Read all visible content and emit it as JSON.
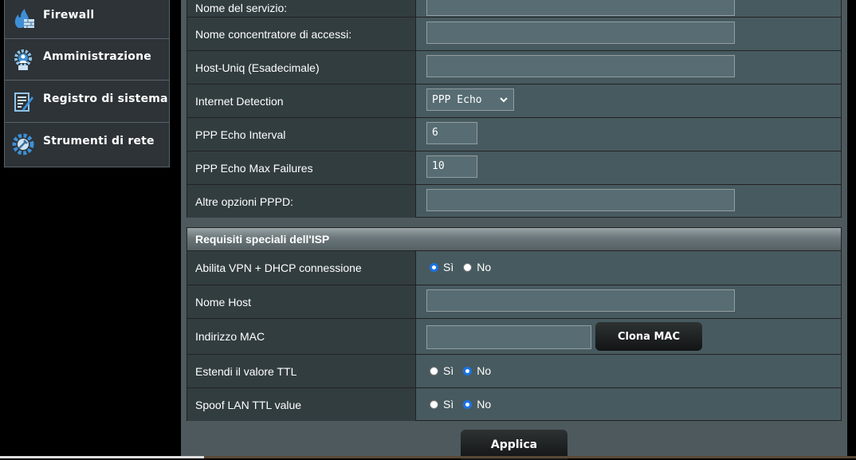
{
  "sidebar": {
    "items": [
      {
        "label": "Firewall",
        "icon": "firewall-icon"
      },
      {
        "label": "Amministrazione",
        "icon": "gear-user-icon"
      },
      {
        "label": "Registro di sistema",
        "icon": "log-icon"
      },
      {
        "label": "Strumenti di rete",
        "icon": "network-tools-icon"
      }
    ]
  },
  "ppp": {
    "service_name_label": "Nome del servizio:",
    "ac_name_label": "Nome concentratore di accessi:",
    "host_uniq_label": "Host-Uniq (Esadecimale)",
    "internet_detection_label": "Internet Detection",
    "internet_detection_value": "PPP Echo",
    "echo_interval_label": "PPP Echo Interval",
    "echo_interval_value": "6",
    "echo_max_failures_label": "PPP Echo Max Failures",
    "echo_max_failures_value": "10",
    "pppd_options_label": "Altre opzioni PPPD:"
  },
  "isp": {
    "section_title": "Requisiti speciali dell'ISP",
    "vpn_dhcp_label": "Abilita VPN + DHCP connessione",
    "host_name_label": "Nome Host",
    "mac_label": "Indirizzo MAC",
    "clone_mac_label": "Clona MAC",
    "extend_ttl_label": "Estendi il valore TTL",
    "spoof_ttl_label": "Spoof LAN TTL value",
    "yes_label": "Sì",
    "no_label": "No"
  },
  "apply_label": "Applica",
  "colors": {
    "accent_radio": "#1a73e8",
    "panel": "#4d595d",
    "label_bg": "#323d40"
  }
}
